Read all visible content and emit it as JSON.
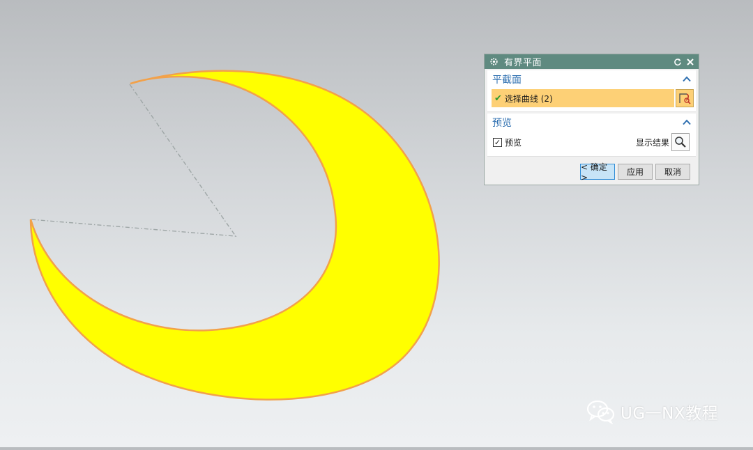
{
  "colors": {
    "shape_fill": "#ffff00",
    "shape_edge": "#f2a14a",
    "curve_dash": "#9ea6a6",
    "titlebar": "#5f8a80",
    "group_title": "#2e6fb0",
    "selection_bg": "#fdd076",
    "primary_border": "#2f8cd6"
  },
  "dialog": {
    "title": "有界平面",
    "title_icon": "gear-icon",
    "reset_icon": "reset-icon",
    "close_icon": "close-icon",
    "sections": {
      "plane_section": {
        "title": "平截面",
        "selection_label": "选择曲线 (2)",
        "selection_icon": "select-curve-icon"
      },
      "preview_section": {
        "title": "预览",
        "checkbox_label": "预览",
        "checkbox_checked": true,
        "show_result_label": "显示结果",
        "show_result_icon": "magnifier-icon"
      }
    },
    "buttons": {
      "ok": "< 确定 >",
      "apply": "应用",
      "cancel": "取消"
    }
  },
  "watermark": {
    "text": "UG一NX教程",
    "icon": "wechat-icon"
  }
}
